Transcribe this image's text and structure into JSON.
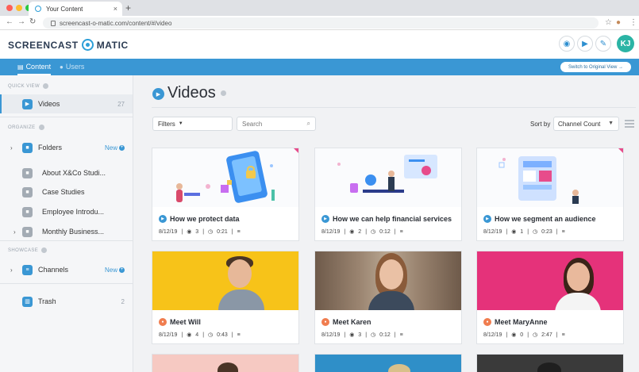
{
  "browser": {
    "tab_title": "Your Content",
    "url": "screencast-o-matic.com/content/#/video",
    "close_glyph": "×",
    "new_tab_glyph": "+"
  },
  "header": {
    "logo_left": "SCREENCAST",
    "logo_right": "MATIC",
    "avatar_initials": "KJ"
  },
  "nav": {
    "tabs": [
      {
        "label": "Content",
        "active": true
      },
      {
        "label": "Users",
        "active": false
      }
    ],
    "switch_label": "Switch to Original View →"
  },
  "sidebar": {
    "quick_view_label": "QUICK VIEW",
    "videos_label": "Videos",
    "videos_count": "27",
    "organize_label": "ORGANIZE",
    "folders_label": "Folders",
    "new_label": "New",
    "folders": [
      {
        "label": "About X&Co Studi..."
      },
      {
        "label": "Case Studies"
      },
      {
        "label": "Employee Introdu..."
      },
      {
        "label": "Monthly Business..."
      }
    ],
    "showcase_label": "SHOWCASE",
    "channels_label": "Channels",
    "trash_label": "Trash",
    "trash_count": "2"
  },
  "main": {
    "title": "Videos",
    "filters_label": "Filters",
    "search_placeholder": "Search",
    "sort_label": "Sort by",
    "sort_value": "Channel Count"
  },
  "videos": [
    {
      "title": "How we protect data",
      "date": "8/12/19",
      "views": "3",
      "duration": "0:21",
      "badge_color": "#3a97d4"
    },
    {
      "title": "How we can help financial services",
      "date": "8/12/19",
      "views": "2",
      "duration": "0:12",
      "badge_color": "#3a97d4"
    },
    {
      "title": "How we segment an audience",
      "date": "8/12/19",
      "views": "1",
      "duration": "0:23",
      "badge_color": "#3a97d4"
    },
    {
      "title": "Meet Will",
      "date": "8/12/19",
      "views": "4",
      "duration": "0:43",
      "badge_color": "#f07d4f"
    },
    {
      "title": "Meet Karen",
      "date": "8/12/19",
      "views": "3",
      "duration": "0:12",
      "badge_color": "#f07d4f"
    },
    {
      "title": "Meet MaryAnne",
      "date": "8/12/19",
      "views": "0",
      "duration": "2:47",
      "badge_color": "#f07d4f"
    }
  ],
  "meta_separator": "|",
  "colors": {
    "accent": "#3a97d4",
    "avatar": "#2bb4a5",
    "people_badge": "#f07d4f",
    "corner_tag": "#e74c8b",
    "thumb_will": "#f7c319",
    "thumb_maryanne": "#e5327a"
  }
}
